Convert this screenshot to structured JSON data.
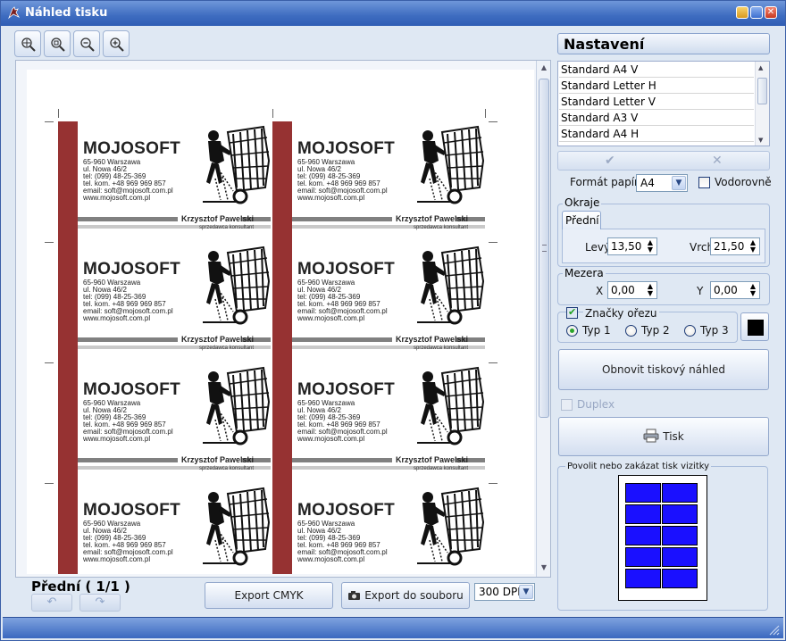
{
  "window": {
    "title": "Náhled tisku"
  },
  "toolbar": {
    "zoom_buttons": [
      "zoom-fit-icon",
      "zoom-page-icon",
      "zoom-out-icon",
      "zoom-in-icon"
    ]
  },
  "card": {
    "company": "MOJOSOFT",
    "address_lines": [
      "65-960 Warszawa",
      "ul. Nowa 46/2",
      "tel: (099) 48-25-369",
      "tel. kom. +48 969 969 857",
      "email: soft@mojosoft.com.pl",
      "www.mojosoft.com.pl"
    ],
    "person": "Krzysztof Pawelski",
    "role": "sprzedawca konsultant",
    "accent_color": "#963232"
  },
  "preview": {
    "side_label": "Přední ( 1/1 )",
    "export_cmyk": "Export CMYK",
    "export_file": "Export do souboru",
    "dpi": "300 DPI"
  },
  "settings": {
    "title": "Nastavení",
    "paper_list": [
      "Standard A4 V",
      "Standard Letter H",
      "Standard Letter V",
      "Standard A3 V",
      "Standard A4 H"
    ],
    "ok_symbol": "✔",
    "cancel_symbol": "✕",
    "paper_format_label": "Formát papíru",
    "paper_format_value": "A4",
    "landscape_label": "Vodorovně",
    "margins": {
      "caption": "Okraje",
      "tab": "Přední",
      "left_label": "Levý",
      "left_value": "13,50",
      "top_label": "Vrch",
      "top_value": "21,50"
    },
    "gap": {
      "caption": "Mezera",
      "x_label": "X",
      "x_value": "0,00",
      "y_label": "Y",
      "y_value": "0,00"
    },
    "crop_marks": {
      "label": "Značky ořezu",
      "type1": "Typ 1",
      "type2": "Typ 2",
      "type3": "Typ 3",
      "mark_color": "#000000"
    },
    "refresh_button": "Obnovit tiskový náhled",
    "duplex_label": "Duplex",
    "print_button": "Tisk",
    "enable_caption": "Povolit nebo zakázat tisk vizitky",
    "enabled_cell_color": "#1a10ff"
  }
}
